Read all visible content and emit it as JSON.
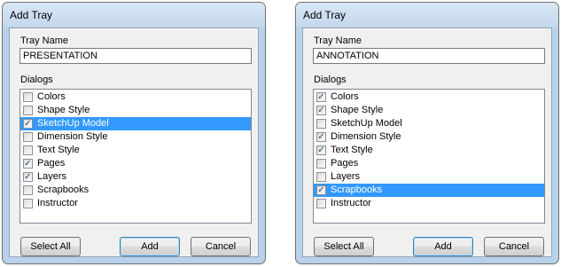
{
  "dialogs": [
    {
      "title": "Add Tray",
      "tray_name_label": "Tray Name",
      "tray_name_value": "PRESENTATION",
      "dialogs_label": "Dialogs",
      "items": [
        {
          "label": "Colors",
          "checked": false,
          "selected": false
        },
        {
          "label": "Shape Style",
          "checked": false,
          "selected": false
        },
        {
          "label": "SketchUp Model",
          "checked": true,
          "selected": true
        },
        {
          "label": "Dimension Style",
          "checked": false,
          "selected": false
        },
        {
          "label": "Text Style",
          "checked": false,
          "selected": false
        },
        {
          "label": "Pages",
          "checked": true,
          "selected": false
        },
        {
          "label": "Layers",
          "checked": true,
          "selected": false
        },
        {
          "label": "Scrapbooks",
          "checked": false,
          "selected": false
        },
        {
          "label": "Instructor",
          "checked": false,
          "selected": false
        }
      ],
      "buttons": {
        "select_all": "Select All",
        "add": "Add",
        "cancel": "Cancel"
      }
    },
    {
      "title": "Add Tray",
      "tray_name_label": "Tray Name",
      "tray_name_value": "ANNOTATION",
      "dialogs_label": "Dialogs",
      "items": [
        {
          "label": "Colors",
          "checked": true,
          "selected": false
        },
        {
          "label": "Shape Style",
          "checked": true,
          "selected": false
        },
        {
          "label": "SketchUp Model",
          "checked": false,
          "selected": false
        },
        {
          "label": "Dimension Style",
          "checked": true,
          "selected": false
        },
        {
          "label": "Text Style",
          "checked": true,
          "selected": false
        },
        {
          "label": "Pages",
          "checked": false,
          "selected": false
        },
        {
          "label": "Layers",
          "checked": false,
          "selected": false
        },
        {
          "label": "Scrapbooks",
          "checked": true,
          "selected": true
        },
        {
          "label": "Instructor",
          "checked": false,
          "selected": false
        }
      ],
      "buttons": {
        "select_all": "Select All",
        "add": "Add",
        "cancel": "Cancel"
      }
    }
  ],
  "colors": {
    "selection_bg": "#3399ff",
    "check_mark": "#214b82",
    "frame": "#b9d1ea"
  }
}
